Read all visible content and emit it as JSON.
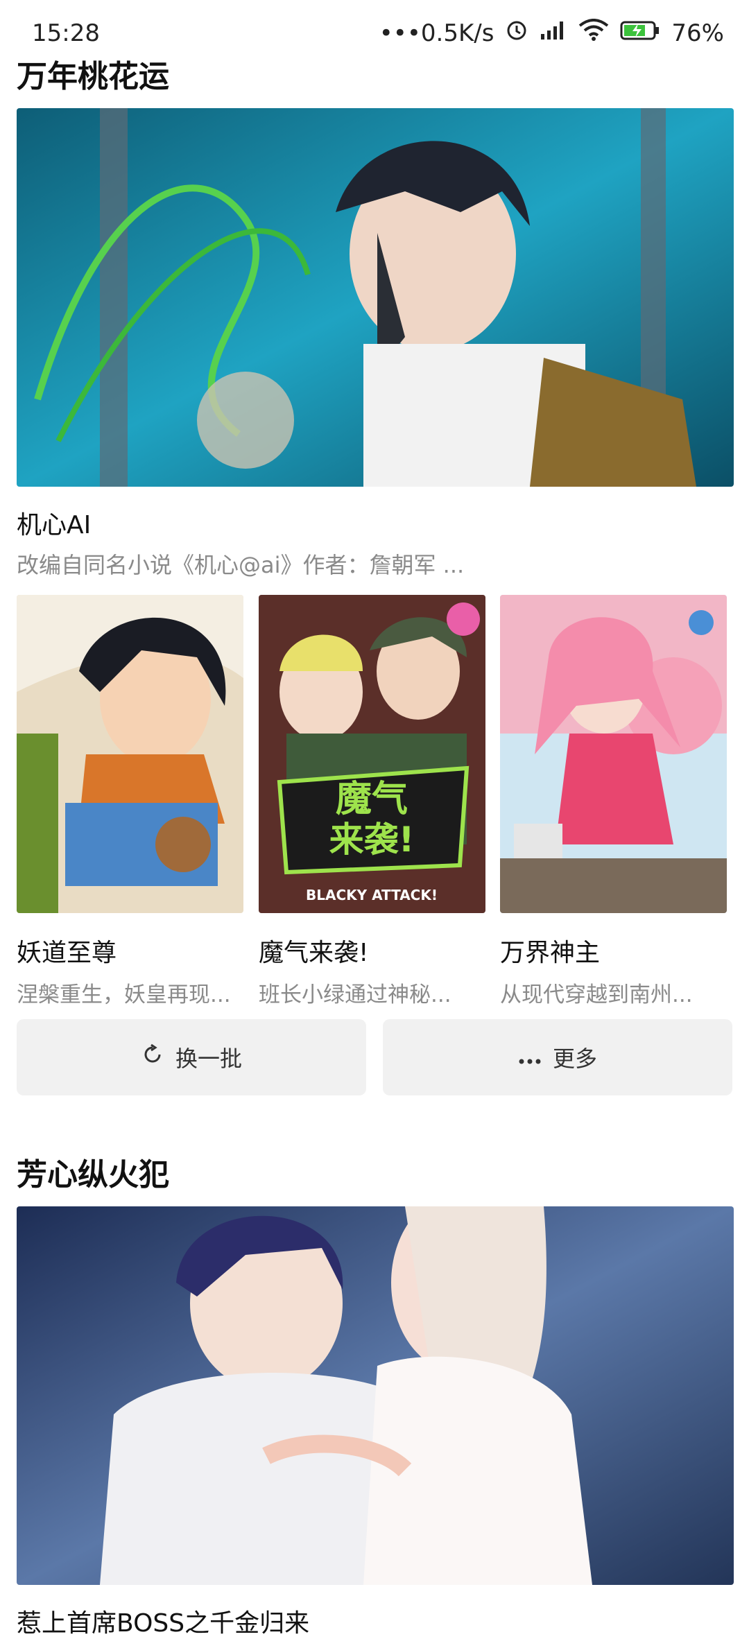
{
  "status_bar": {
    "time": "15:28",
    "network_speed": "•••0.5K/s",
    "battery": "76%",
    "icons": [
      "alarm-icon",
      "signal-icon",
      "wifi-icon",
      "battery-icon"
    ]
  },
  "section1": {
    "title": "万年桃花运",
    "featured": {
      "title": "机心AI",
      "description": "改编自同名小说《机心@ai》作者：詹朝军 ..."
    },
    "grid": [
      {
        "title": "妖道至尊",
        "description": "涅槃重生，妖皇再现..."
      },
      {
        "title": "魔气来袭!",
        "description": "班长小绿通过神秘..."
      },
      {
        "title": "万界神主",
        "description": "从现代穿越到南州..."
      }
    ],
    "buttons": {
      "refresh_label": "换一批",
      "more_label": "更多"
    }
  },
  "section2": {
    "title": "芳心纵火犯",
    "featured": {
      "title": "惹上首席BOSS之千金归来"
    }
  },
  "colors": {
    "button_bg": "#f1f1f1",
    "desc_text": "#8a8a8a"
  }
}
